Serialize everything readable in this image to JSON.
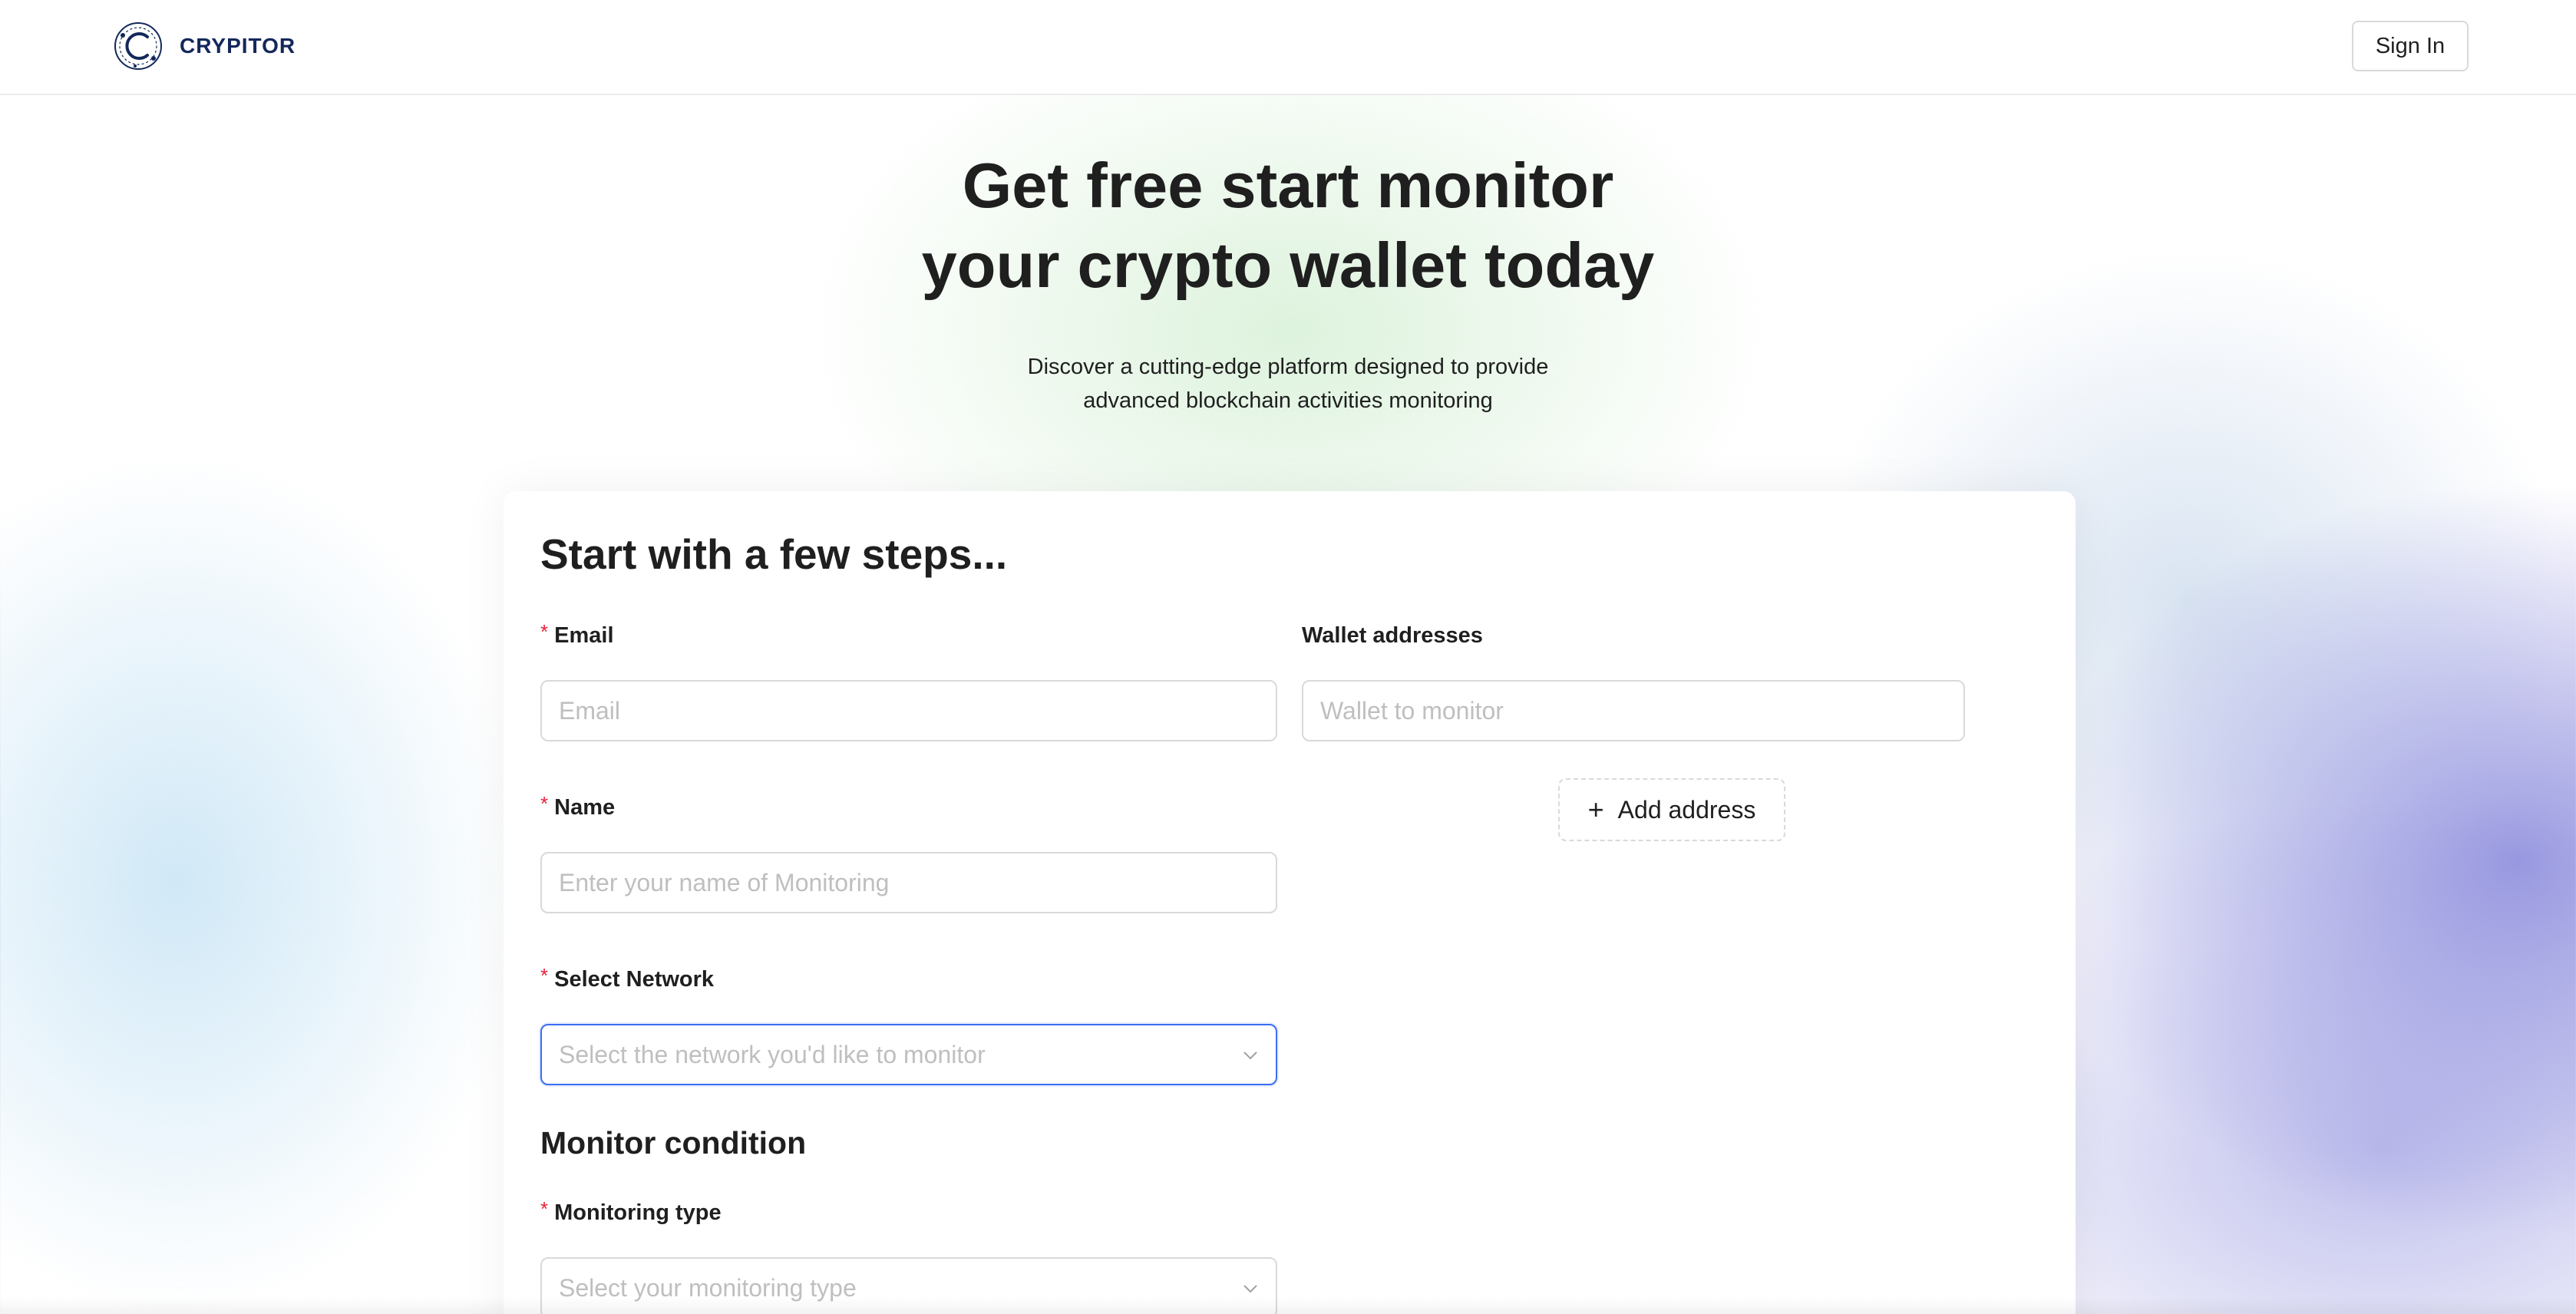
{
  "brand": {
    "name": "CRYPITOR",
    "icon": "crypitor-logo-icon"
  },
  "header": {
    "signin_label": "Sign In"
  },
  "hero": {
    "title_line1": "Get free start monitor",
    "title_line2": "your crypto wallet today",
    "subtitle_line1": "Discover a cutting-edge platform designed to provide",
    "subtitle_line2": "advanced blockchain activities monitoring"
  },
  "form": {
    "title": "Start with a few steps...",
    "email": {
      "label": "Email",
      "required": true,
      "placeholder": "Email"
    },
    "wallet": {
      "label": "Wallet addresses",
      "required": false,
      "placeholder": "Wallet to monitor"
    },
    "add_address": {
      "label": "Add address",
      "icon": "plus-icon"
    },
    "name": {
      "label": "Name",
      "required": true,
      "placeholder": "Enter your name of Monitoring"
    },
    "network": {
      "label": "Select Network",
      "required": true,
      "placeholder": "Select the network you'd like to monitor",
      "icon": "chevron-down-icon"
    },
    "monitor_section_title": "Monitor condition",
    "monitoring_type": {
      "label": "Monitoring type",
      "required": true,
      "placeholder": "Select your monitoring type",
      "icon": "chevron-down-icon"
    },
    "required_marker": "*"
  },
  "colors": {
    "accent": "#3a6ef2",
    "required": "#e6233c",
    "brand_text": "#13285a",
    "placeholder": "#bfbfbf"
  }
}
